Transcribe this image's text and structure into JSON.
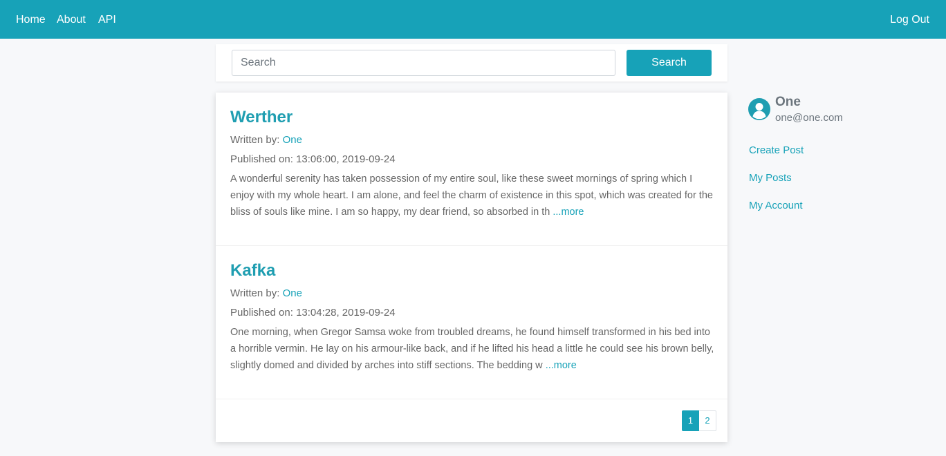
{
  "nav": {
    "home": "Home",
    "about": "About",
    "api": "API",
    "logout": "Log Out"
  },
  "search": {
    "placeholder": "Search",
    "value": "",
    "button_label": "Search"
  },
  "posts": [
    {
      "title": "Werther",
      "written_by_label": "Written by:",
      "author": "One",
      "published_label": "Published on:",
      "published": "13:06:00, 2019-09-24",
      "excerpt": "A wonderful serenity has taken possession of my entire soul, like these sweet mornings of spring which I enjoy with my whole heart. I am alone, and feel the charm of existence in this spot, which was created for the bliss of souls like mine. I am so happy, my dear friend, so absorbed in th ",
      "more": "...more"
    },
    {
      "title": "Kafka",
      "written_by_label": "Written by:",
      "author": "One",
      "published_label": "Published on:",
      "published": "13:04:28, 2019-09-24",
      "excerpt": "One morning, when Gregor Samsa woke from troubled dreams, he found himself transformed in his bed into a horrible vermin. He lay on his armour-like back, and if he lifted his head a little he could see his brown belly, slightly domed and divided by arches into stiff sections. The bedding w ",
      "more": "...more"
    }
  ],
  "pagination": {
    "pages": [
      "1",
      "2"
    ],
    "current": "1"
  },
  "sidebar": {
    "user_name": "One",
    "user_email": "one@one.com",
    "avatar_icon": "user-avatar-icon",
    "links": {
      "create_post": "Create Post",
      "my_posts": "My Posts",
      "my_account": "My Account"
    }
  },
  "colors": {
    "accent": "#17a2b8",
    "title": "#1f9eb1",
    "background": "#f7f8fa"
  }
}
